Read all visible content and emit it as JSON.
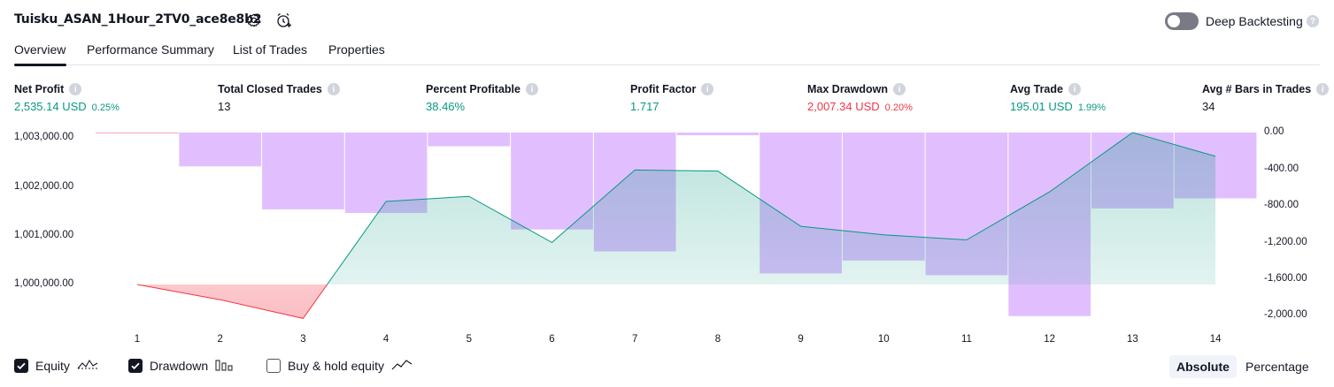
{
  "header": {
    "strategy_name": "Tuisku_ASAN_1Hour_2TV0_ace8e8b2",
    "settings_icon": "gear-icon",
    "alert_icon": "alarm-clock-plus-icon",
    "deep_backtesting_label": "Deep Backtesting",
    "deep_backtesting_enabled": false,
    "help_icon": "question-icon"
  },
  "tabs": [
    {
      "label": "Overview",
      "active": true
    },
    {
      "label": "Performance Summary",
      "active": false
    },
    {
      "label": "List of Trades",
      "active": false
    },
    {
      "label": "Properties",
      "active": false
    }
  ],
  "metrics": [
    {
      "label": "Net Profit",
      "value": "2,535.14 USD",
      "pct": "0.25%",
      "color": "#089981"
    },
    {
      "label": "Total Closed Trades",
      "value": "13",
      "pct": "",
      "color": "#131722"
    },
    {
      "label": "Percent Profitable",
      "value": "38.46%",
      "pct": "",
      "color": "#089981"
    },
    {
      "label": "Profit Factor",
      "value": "1.717",
      "pct": "",
      "color": "#089981"
    },
    {
      "label": "Max Drawdown",
      "value": "2,007.34 USD",
      "pct": "0.20%",
      "color": "#f23645"
    },
    {
      "label": "Avg Trade",
      "value": "195.01 USD",
      "pct": "1.99%",
      "color": "#089981"
    },
    {
      "label": "Avg # Bars in Trades",
      "value": "34",
      "pct": "",
      "color": "#131722"
    }
  ],
  "chart_data": {
    "type": "line",
    "x": [
      1,
      2,
      3,
      4,
      5,
      6,
      7,
      8,
      9,
      10,
      11,
      12,
      13,
      14
    ],
    "x_tick_labels": [
      "1",
      "2",
      "3",
      "4",
      "5",
      "6",
      "7",
      "8",
      "9",
      "10",
      "11",
      "12",
      "13",
      "14"
    ],
    "left_axis": {
      "tick_labels": [
        "1,003,000.00",
        "1,002,000.00",
        "1,001,000.00",
        "1,000,000.00"
      ],
      "ticks": [
        1003000,
        1002000,
        1001000,
        1000000
      ],
      "baseline": 1000000,
      "range": [
        997300,
        1003000
      ]
    },
    "right_axis": {
      "tick_labels": [
        "0.00",
        "-400.00",
        "-800.00",
        "-1,200.00",
        "-1,600.00",
        "-2,000.00"
      ],
      "ticks": [
        0,
        -400,
        -800,
        -1200,
        -1600,
        -2000
      ],
      "range": [
        -2100,
        0
      ]
    },
    "series": [
      {
        "name": "Equity",
        "axis": "left",
        "color_up": "#089981",
        "color_down": "#f23645",
        "values": [
          1000000,
          999700,
          999330,
          1001640,
          1001740,
          1000830,
          1002260,
          1002240,
          1001150,
          1000980,
          1000880,
          1001830,
          1003000,
          1002530
        ]
      },
      {
        "name": "Drawdown",
        "axis": "right",
        "type": "bar",
        "color": "#e1bfff",
        "values": [
          0,
          -370,
          -840,
          -880,
          -150,
          -1060,
          -1300,
          -30,
          -1540,
          -1400,
          -1560,
          -2007,
          -830,
          -720
        ]
      }
    ],
    "grid": false
  },
  "legend": {
    "items": [
      {
        "label": "Equity",
        "checked": true,
        "icon": "equity-line-icon"
      },
      {
        "label": "Drawdown",
        "checked": true,
        "icon": "drawdown-bars-icon"
      },
      {
        "label": "Buy & hold equity",
        "checked": false,
        "icon": "buy-hold-line-icon"
      }
    ]
  },
  "modes": [
    {
      "label": "Absolute",
      "active": true
    },
    {
      "label": "Percentage",
      "active": false
    }
  ]
}
